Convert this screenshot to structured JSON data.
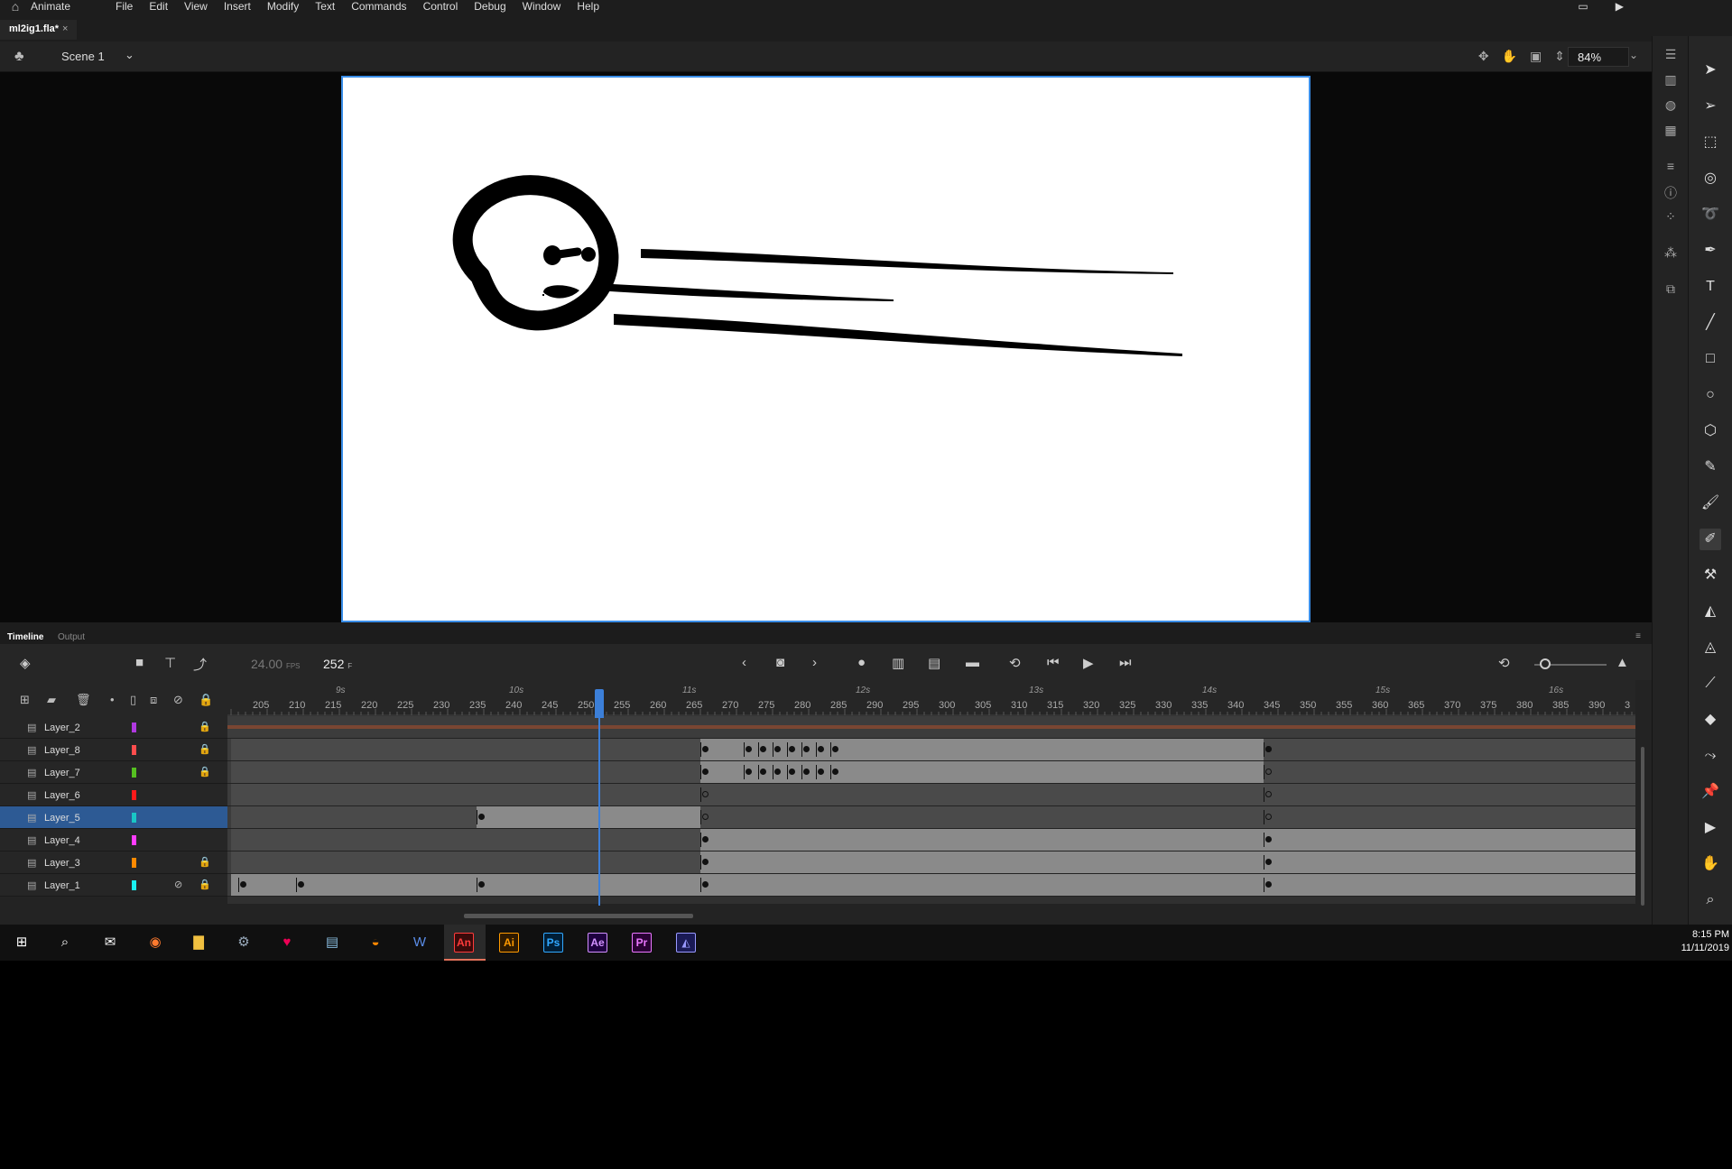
{
  "menubar": {
    "app_name": "Animate",
    "items": [
      "File",
      "Edit",
      "View",
      "Insert",
      "Modify",
      "Text",
      "Commands",
      "Control",
      "Debug",
      "Window",
      "Help"
    ]
  },
  "document": {
    "tab_title": "ml2ig1.fla*",
    "close_glyph": "×"
  },
  "editbar": {
    "scene": "Scene 1",
    "zoom": "84%"
  },
  "timeline": {
    "tabs": [
      "Timeline",
      "Output"
    ],
    "fps": "24.00",
    "fps_unit": "FPS",
    "current_frame": "252",
    "frame_unit": "F",
    "seconds": [
      "9s",
      "10s",
      "11s",
      "12s",
      "13s",
      "14s",
      "15s",
      "16s"
    ],
    "frame_numbers": [
      "205",
      "210",
      "215",
      "220",
      "225",
      "230",
      "235",
      "240",
      "245",
      "250",
      "255",
      "260",
      "265",
      "270",
      "275",
      "280",
      "285",
      "290",
      "295",
      "300",
      "305",
      "310",
      "315",
      "320",
      "325",
      "330",
      "335",
      "340",
      "345",
      "350",
      "355",
      "360",
      "365",
      "370",
      "375",
      "380",
      "385",
      "390",
      "3"
    ],
    "layers": [
      {
        "name": "Layer_2",
        "color": "#b039e0",
        "locked": true,
        "hidden": false,
        "selected": false
      },
      {
        "name": "Layer_8",
        "color": "#ff4d4d",
        "locked": true,
        "hidden": false,
        "selected": false
      },
      {
        "name": "Layer_7",
        "color": "#55c020",
        "locked": true,
        "hidden": false,
        "selected": false
      },
      {
        "name": "Layer_6",
        "color": "#ff1a1a",
        "locked": false,
        "hidden": false,
        "selected": false
      },
      {
        "name": "Layer_5",
        "color": "#19c6c6",
        "locked": false,
        "hidden": false,
        "selected": true
      },
      {
        "name": "Layer_4",
        "color": "#ff3cff",
        "locked": false,
        "hidden": false,
        "selected": false
      },
      {
        "name": "Layer_3",
        "color": "#ff8a00",
        "locked": true,
        "hidden": false,
        "selected": false
      },
      {
        "name": "Layer_1",
        "color": "#19f0f0",
        "locked": true,
        "hidden": true,
        "selected": false
      }
    ]
  },
  "taskbar": {
    "time": "8:15 PM",
    "date": "11/11/2019",
    "apps": [
      "An",
      "Ai",
      "Ps",
      "Ae",
      "Pr"
    ]
  }
}
